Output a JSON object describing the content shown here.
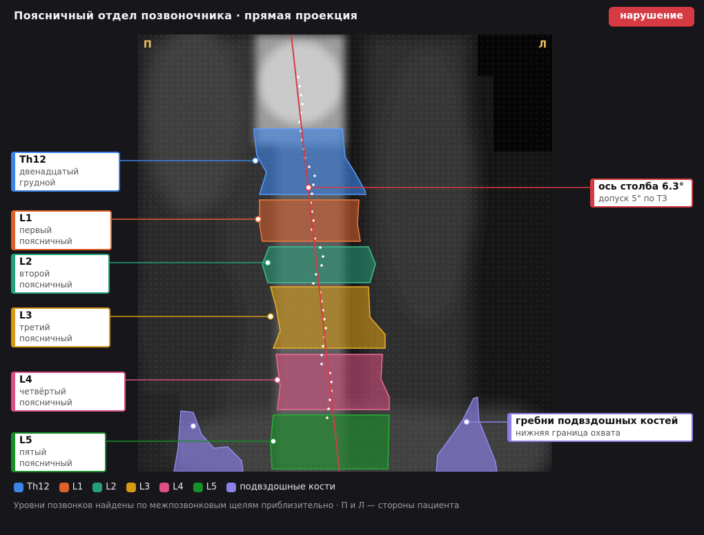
{
  "header": {
    "title": "Поясничный отдел позвоночника · прямая проекция",
    "status_badge": "нарушение"
  },
  "scan": {
    "side_right_marker": "П",
    "side_left_marker": "Л"
  },
  "vertebrae": [
    {
      "code": "Th12",
      "name": "двенадцатый грудной",
      "color": "#3c84e6"
    },
    {
      "code": "L1",
      "name": "первый поясничный",
      "color": "#e0602c"
    },
    {
      "code": "L2",
      "name": "второй поясничный",
      "color": "#25a07c"
    },
    {
      "code": "L3",
      "name": "третий поясничный",
      "color": "#d49a16"
    },
    {
      "code": "L4",
      "name": "четвёртый поясничный",
      "color": "#dc5082"
    },
    {
      "code": "L5",
      "name": "пятый поясничный",
      "color": "#189028"
    }
  ],
  "axis_callout": {
    "title": "ось столба 6.3°",
    "subtitle": "допуск 5° по ТЗ",
    "color": "#d63b44"
  },
  "iliac_callout": {
    "title": "гребни подвздошных костей",
    "subtitle": "нижняя граница охвата",
    "color": "#8a80e6"
  },
  "legend": [
    {
      "label": "Th12",
      "color": "#3c84e6"
    },
    {
      "label": "L1",
      "color": "#e0602c"
    },
    {
      "label": "L2",
      "color": "#25a07c"
    },
    {
      "label": "L3",
      "color": "#d49a16"
    },
    {
      "label": "L4",
      "color": "#dc5082"
    },
    {
      "label": "L5",
      "color": "#189028"
    },
    {
      "label": "подвздошные кости",
      "color": "#8a80e6"
    }
  ],
  "footnote": "Уровни позвонков найдены по межпозвонковым щелям приблизительно · П и Л — стороны пациента"
}
